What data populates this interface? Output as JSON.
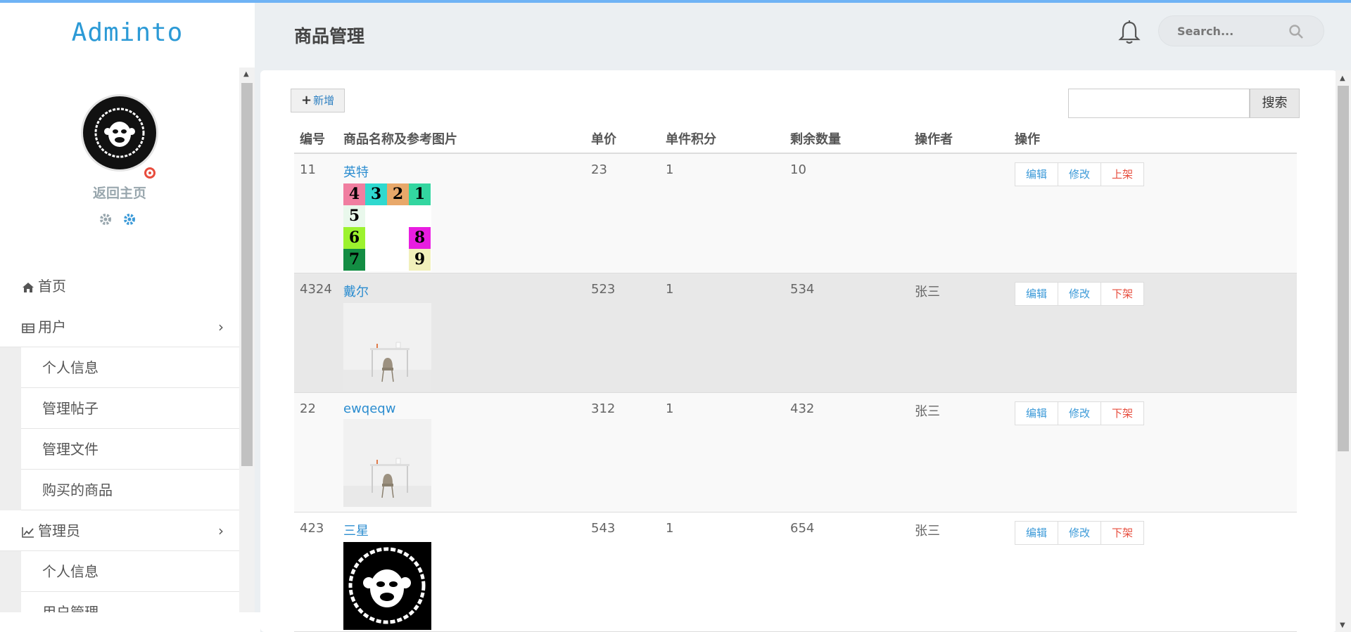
{
  "app": {
    "logo": "Adminto"
  },
  "sidebar": {
    "home_link": "返回主页",
    "menu": [
      {
        "label": "首页",
        "icon": "home-icon"
      },
      {
        "label": "用户",
        "icon": "table-icon"
      },
      {
        "label": "个人信息"
      },
      {
        "label": "管理帖子"
      },
      {
        "label": "管理文件"
      },
      {
        "label": "购买的商品"
      },
      {
        "label": "管理员",
        "icon": "line-chart-icon"
      },
      {
        "label": "个人信息"
      },
      {
        "label": "用户管理"
      }
    ]
  },
  "header": {
    "title": "商品管理",
    "search_placeholder": "Search..."
  },
  "toolbar": {
    "add_label": "新增",
    "search_btn": "搜索"
  },
  "table": {
    "columns": [
      "编号",
      "商品名称及参考图片",
      "单价",
      "单件积分",
      "剩余数量",
      "操作者",
      "操作"
    ],
    "ops": {
      "edit": "编辑",
      "modify": "修改"
    },
    "rows": [
      {
        "id": "11",
        "name": "英特",
        "price": "23",
        "points": "1",
        "stock": "10",
        "operator": "",
        "toggle": "上架",
        "image": "number-grid"
      },
      {
        "id": "4324",
        "name": "戴尔",
        "price": "523",
        "points": "1",
        "stock": "534",
        "operator": "张三",
        "toggle": "下架",
        "image": "desk-photo"
      },
      {
        "id": "22",
        "name": "ewqeqw",
        "price": "312",
        "points": "1",
        "stock": "432",
        "operator": "张三",
        "toggle": "下架",
        "image": "desk-photo"
      },
      {
        "id": "423",
        "name": "三星",
        "price": "543",
        "points": "1",
        "stock": "654",
        "operator": "张三",
        "toggle": "下架",
        "image": "monkey-logo"
      }
    ]
  },
  "numgrid": [
    "4",
    "3",
    "2",
    "1",
    "5",
    "6",
    "8",
    "7",
    "9"
  ]
}
